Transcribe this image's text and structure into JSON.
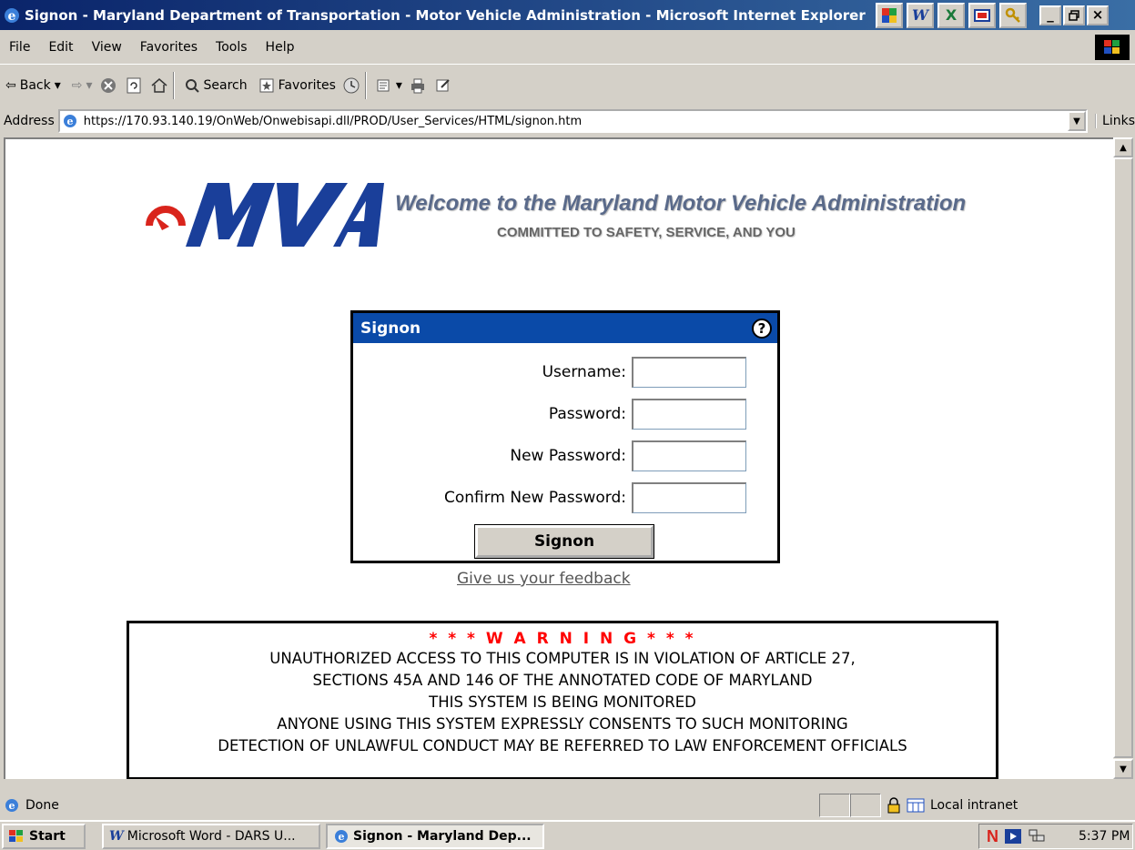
{
  "window": {
    "title": "Signon - Maryland Department of Transportation - Motor Vehicle Administration - Microsoft Internet Explorer",
    "minimize": "_",
    "restore": "§",
    "close": "×"
  },
  "menu": {
    "items": [
      "File",
      "Edit",
      "View",
      "Favorites",
      "Tools",
      "Help"
    ]
  },
  "toolbar": {
    "back": "Back",
    "search": "Search",
    "favorites": "Favorites"
  },
  "address": {
    "label": "Address",
    "url": "https://170.93.140.19/OnWeb/Onwebisapi.dll/PROD/User_Services/HTML/signon.htm",
    "links": "Links"
  },
  "page": {
    "welcome": "Welcome to the Maryland Motor Vehicle Administration",
    "committed": "COMMITTED TO SAFETY, SERVICE, AND YOU",
    "signon": {
      "header": "Signon",
      "help": "?",
      "fields": [
        {
          "label": "Username:",
          "value": ""
        },
        {
          "label": "Password:",
          "value": ""
        },
        {
          "label": "New Password:",
          "value": ""
        },
        {
          "label": "Confirm New Password:",
          "value": ""
        }
      ],
      "button": "Signon"
    },
    "feedback": "Give us your feedback",
    "warning": {
      "title": "* * * W A R N I N G * * *",
      "lines": [
        "UNAUTHORIZED ACCESS TO THIS COMPUTER IS IN VIOLATION OF ARTICLE 27,",
        "SECTIONS 45A AND 146 OF THE ANNOTATED CODE OF MARYLAND",
        "THIS SYSTEM IS BEING MONITORED",
        "ANYONE USING THIS SYSTEM EXPRESSLY CONSENTS TO SUCH MONITORING",
        "DETECTION OF UNLAWFUL CONDUCT MAY BE REFERRED TO LAW ENFORCEMENT OFFICIALS"
      ]
    }
  },
  "status": {
    "text": "Done",
    "zone": "Local intranet"
  },
  "taskbar": {
    "start": "Start",
    "tasks": [
      {
        "label": "Microsoft Word - DARS U..."
      },
      {
        "label": "Signon - Maryland Dep..."
      }
    ],
    "clock": "5:37 PM"
  },
  "colors": {
    "signon_header": "#0a4aa8",
    "warning_red": "#ff0000",
    "logo_red": "#d9241c",
    "logo_blue": "#1a3f9a"
  }
}
